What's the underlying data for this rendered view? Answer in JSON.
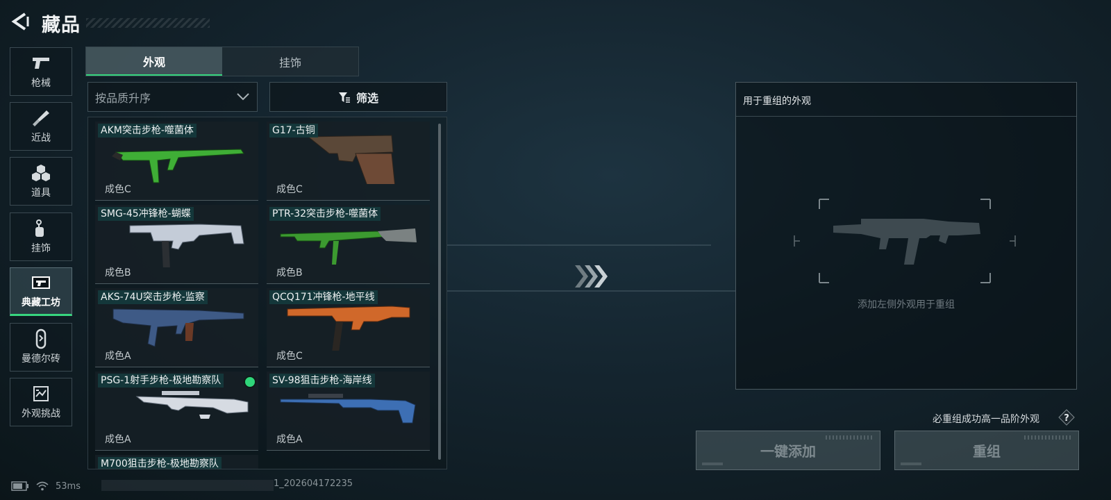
{
  "header": {
    "title": "藏品"
  },
  "nav": [
    {
      "label": "枪械",
      "icon": "pistol-icon"
    },
    {
      "label": "近战",
      "icon": "knife-icon"
    },
    {
      "label": "道具",
      "icon": "grenade-icon"
    },
    {
      "label": "挂饰",
      "icon": "charm-icon"
    },
    {
      "label": "典藏工坊",
      "icon": "workshop-icon",
      "active": true
    },
    {
      "label": "曼德尔砖",
      "icon": "brick-icon"
    },
    {
      "label": "外观挑战",
      "icon": "challenge-icon"
    }
  ],
  "tabs": [
    {
      "label": "外观",
      "active": true
    },
    {
      "label": "挂饰"
    }
  ],
  "sort": {
    "value": "按品质升序"
  },
  "filter": {
    "label": "筛选"
  },
  "skins": [
    {
      "name": "AKM突击步枪-噬菌体",
      "grade": "成色C",
      "color": "#3fae36"
    },
    {
      "name": "G17-古铜",
      "grade": "成色C",
      "color": "#6e4a36"
    },
    {
      "name": "SMG-45冲锋枪-蝴蝶",
      "grade": "成色B",
      "color": "#c4ccd8"
    },
    {
      "name": "PTR-32突击步枪-噬菌体",
      "grade": "成色B",
      "color": "#3c9a30"
    },
    {
      "name": "AKS-74U突击步枪-监察",
      "grade": "成色A",
      "color": "#3e5a86"
    },
    {
      "name": "QCQ171冲锋枪-地平线",
      "grade": "成色C",
      "color": "#d0682a"
    },
    {
      "name": "PSG-1射手步枪-极地勘察队",
      "grade": "成色A",
      "color": "#d6dbe2",
      "equipped": true
    },
    {
      "name": "SV-98狙击步枪-海岸线",
      "grade": "成色A",
      "color": "#3d6fb4"
    }
  ],
  "partial_item": {
    "name": "M700狙击步枪-极地勘察队"
  },
  "panel": {
    "title": "用于重组的外观",
    "hint": "添加左侧外观用于重组"
  },
  "guarantee": {
    "text": "必重组成功高一品阶外观"
  },
  "buttons": {
    "add": "一键添加",
    "recompose": "重组"
  },
  "status": {
    "ping": "53ms",
    "build": "1_202604172235"
  }
}
